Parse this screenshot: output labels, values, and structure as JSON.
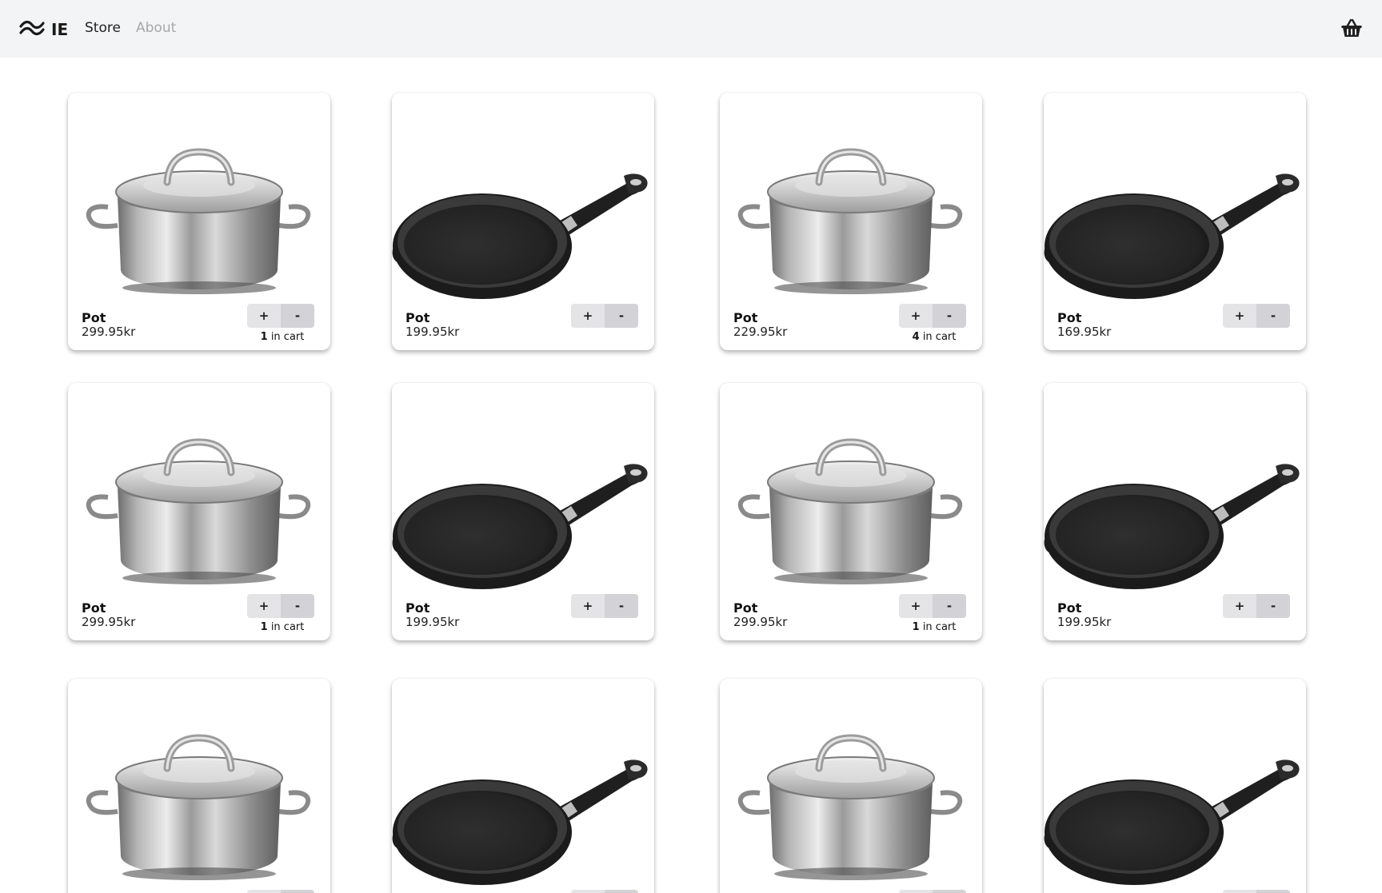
{
  "brand": {
    "icon": "wave-logo-icon",
    "name": "IE"
  },
  "nav": {
    "store": "Store",
    "about": "About"
  },
  "header": {
    "cart_icon": "basket-icon"
  },
  "buttons": {
    "plus": "+",
    "minus": "-"
  },
  "cart_suffix": "in cart",
  "products": [
    {
      "name": "Pot",
      "price": "299.95kr",
      "kind": "pot",
      "in_cart": "1"
    },
    {
      "name": "Pot",
      "price": "199.95kr",
      "kind": "pan",
      "in_cart": ""
    },
    {
      "name": "Pot",
      "price": "229.95kr",
      "kind": "pot",
      "in_cart": "4"
    },
    {
      "name": "Pot",
      "price": "169.95kr",
      "kind": "pan",
      "in_cart": ""
    },
    {
      "name": "Pot",
      "price": "299.95kr",
      "kind": "pot",
      "in_cart": "1"
    },
    {
      "name": "Pot",
      "price": "199.95kr",
      "kind": "pan",
      "in_cart": ""
    },
    {
      "name": "Pot",
      "price": "299.95kr",
      "kind": "pot",
      "in_cart": "1"
    },
    {
      "name": "Pot",
      "price": "199.95kr",
      "kind": "pan",
      "in_cart": ""
    },
    {
      "name": "",
      "price": "",
      "kind": "pot",
      "in_cart": ""
    },
    {
      "name": "",
      "price": "",
      "kind": "pan",
      "in_cart": ""
    },
    {
      "name": "",
      "price": "",
      "kind": "pot",
      "in_cart": ""
    },
    {
      "name": "",
      "price": "",
      "kind": "pan",
      "in_cart": ""
    }
  ]
}
